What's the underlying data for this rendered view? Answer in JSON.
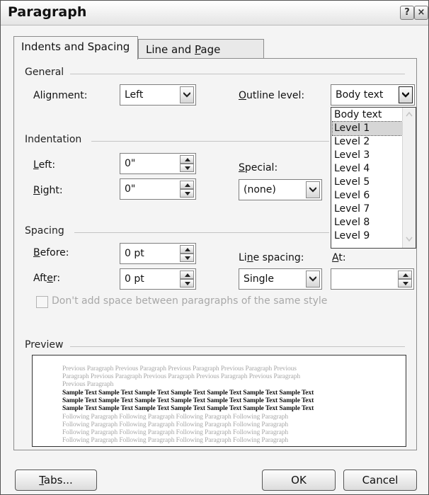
{
  "window": {
    "title": "Paragraph",
    "help_glyph": "?",
    "close_glyph": "×"
  },
  "tabs": [
    {
      "label": "Indents and Spacing"
    },
    {
      "label_prefix": "Line and ",
      "label_mnemonic": "P",
      "label_suffix": "age Breaks"
    }
  ],
  "general": {
    "section_label": "General",
    "alignment_label": "Alignment:",
    "alignment_value": "Left",
    "outline_label_mnemonic": "O",
    "outline_label_rest": "utline level:",
    "outline_value": "Body text"
  },
  "outline_options": [
    "Body text",
    "Level 1",
    "Level 2",
    "Level 3",
    "Level 4",
    "Level 5",
    "Level 6",
    "Level 7",
    "Level 8",
    "Level 9"
  ],
  "indentation": {
    "section_label": "Indentation",
    "left_mnemonic": "L",
    "left_rest": "eft:",
    "left_value": "0\"",
    "right_mnemonic": "R",
    "right_rest": "ight:",
    "right_value": "0\"",
    "special_mnemonic": "S",
    "special_rest": "pecial:",
    "special_value": "(none)"
  },
  "spacing": {
    "section_label": "Spacing",
    "before_mnemonic": "B",
    "before_rest": "efore:",
    "before_value": "0 pt",
    "after_prefix": "Aft",
    "after_mnemonic": "e",
    "after_suffix": "r:",
    "after_value": "0 pt",
    "line_spacing_prefix": "Li",
    "line_spacing_mnemonic": "n",
    "line_spacing_suffix": "e spacing:",
    "line_spacing_value": "Single",
    "at_mnemonic": "A",
    "at_rest": "t:",
    "at_value": ""
  },
  "checkbox": {
    "label": "Don't add space between paragraphs of the same style",
    "checked": false
  },
  "preview": {
    "section_label": "Preview",
    "previous_lines": [
      "Previous Paragraph Previous Paragraph Previous Paragraph Previous Paragraph Previous",
      "Paragraph Previous Paragraph Previous Paragraph Previous Paragraph Previous Paragraph",
      "Previous Paragraph"
    ],
    "sample_lines": [
      "Sample Text Sample Text Sample Text Sample Text Sample Text Sample Text Sample Text",
      "Sample Text Sample Text Sample Text Sample Text Sample Text Sample Text Sample Text",
      "Sample Text Sample Text Sample Text Sample Text Sample Text Sample Text Sample Text"
    ],
    "following_lines": [
      "Following Paragraph Following Paragraph Following Paragraph Following Paragraph",
      "Following Paragraph Following Paragraph Following Paragraph Following Paragraph",
      "Following Paragraph Following Paragraph Following Paragraph Following Paragraph",
      "Following Paragraph Following Paragraph Following Paragraph Following Paragraph"
    ]
  },
  "buttons": {
    "tabs_mnemonic": "T",
    "tabs_rest": "abs...",
    "ok": "OK",
    "cancel": "Cancel"
  }
}
